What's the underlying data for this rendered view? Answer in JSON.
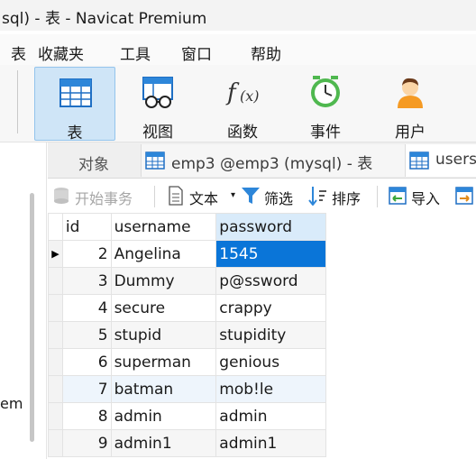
{
  "window": {
    "title": "sql) - 表 - Navicat Premium"
  },
  "menu": {
    "items": [
      "表",
      "收藏夹",
      "工具",
      "窗口",
      "帮助"
    ]
  },
  "toolbar": {
    "buttons": [
      {
        "label": "表",
        "icon": "table-icon"
      },
      {
        "label": "视图",
        "icon": "view-icon"
      },
      {
        "label": "函数",
        "icon": "function-icon"
      },
      {
        "label": "事件",
        "icon": "event-clock-icon"
      },
      {
        "label": "用户",
        "icon": "user-icon"
      }
    ]
  },
  "sidebar": {
    "fragment_text": "em"
  },
  "tabs": {
    "objects_label": "对象",
    "tab1_label": "emp3 @emp3 (mysql) - 表",
    "tab2_label": "users"
  },
  "subtoolbar": {
    "begin_transaction": "开始事务",
    "text": "文本",
    "filter": "筛选",
    "sort": "排序",
    "import": "导入"
  },
  "grid": {
    "columns": [
      "id",
      "username",
      "password"
    ],
    "rows": [
      {
        "id": "2",
        "username": "Angelina",
        "password": "1545"
      },
      {
        "id": "3",
        "username": "Dummy",
        "password": "p@ssword"
      },
      {
        "id": "4",
        "username": "secure",
        "password": "crappy"
      },
      {
        "id": "5",
        "username": "stupid",
        "password": "stupidity"
      },
      {
        "id": "6",
        "username": "superman",
        "password": "genious"
      },
      {
        "id": "7",
        "username": "batman",
        "password": "mob!le"
      },
      {
        "id": "8",
        "username": "admin",
        "password": "admin"
      },
      {
        "id": "9",
        "username": "admin1",
        "password": "admin1"
      }
    ]
  },
  "colors": {
    "selection": "#0a75d8",
    "active_tool": "#cfe5f7",
    "header_highlight": "#d9ebfa"
  }
}
